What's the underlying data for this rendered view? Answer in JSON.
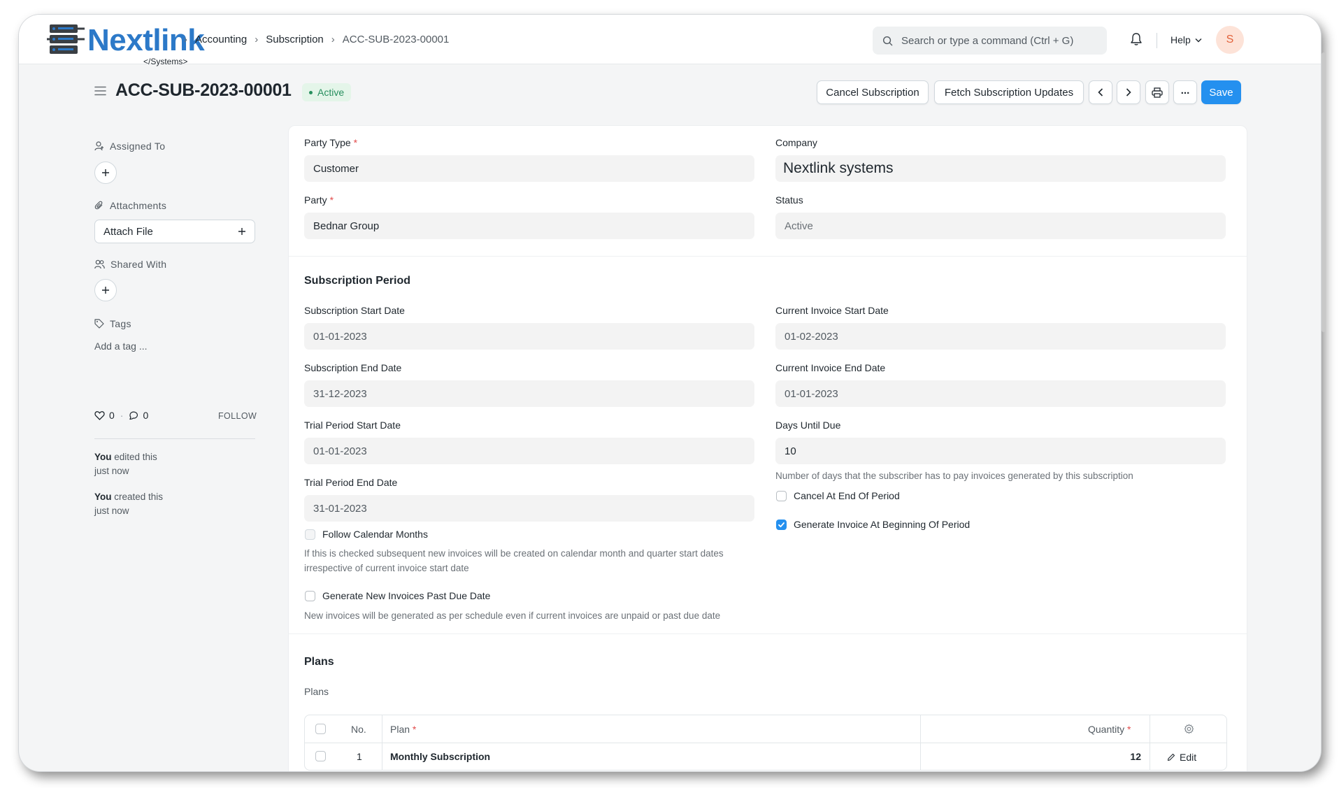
{
  "navbar": {
    "logo_text": "Nextlink",
    "logo_sub": "</Systems>",
    "breadcrumbs": [
      "Accounting",
      "Subscription",
      "ACC-SUB-2023-00001"
    ],
    "search_placeholder": "Search or type a command (Ctrl + G)",
    "help_label": "Help",
    "avatar_initial": "S"
  },
  "header": {
    "title": "ACC-SUB-2023-00001",
    "status": "Active",
    "buttons": {
      "cancel": "Cancel Subscription",
      "fetch": "Fetch Subscription Updates",
      "more": "...",
      "save": "Save"
    }
  },
  "sidebar": {
    "assigned_to": "Assigned To",
    "attachments": "Attachments",
    "attach_file": "Attach File",
    "shared_with": "Shared With",
    "tags": "Tags",
    "add_tag": "Add a tag ...",
    "likes": "0",
    "comments": "0",
    "follow": "FOLLOW",
    "activity": [
      {
        "who": "You",
        "action": " edited this",
        "when": "just now"
      },
      {
        "who": "You",
        "action": " created this",
        "when": "just now"
      }
    ]
  },
  "form": {
    "party_type_label": "Party Type",
    "party_type": "Customer",
    "company_label": "Company",
    "company": "Nextlink systems",
    "party_label": "Party",
    "party": "Bednar Group",
    "status_label": "Status",
    "status": "Active",
    "period_section": "Subscription Period",
    "sub_start_label": "Subscription Start Date",
    "sub_start": "01-01-2023",
    "sub_end_label": "Subscription End Date",
    "sub_end": "31-12-2023",
    "trial_start_label": "Trial Period Start Date",
    "trial_start": "01-01-2023",
    "trial_end_label": "Trial Period End Date",
    "trial_end": "31-01-2023",
    "cur_inv_start_label": "Current Invoice Start Date",
    "cur_inv_start": "01-02-2023",
    "cur_inv_end_label": "Current Invoice End Date",
    "cur_inv_end": "01-01-2023",
    "days_due_label": "Days Until Due",
    "days_due": "10",
    "days_due_desc": "Number of days that the subscriber has to pay invoices generated by this subscription",
    "cancel_end_label": "Cancel At End Of Period",
    "cancel_end_checked": false,
    "gen_begin_label": "Generate Invoice At Beginning Of Period",
    "gen_begin_checked": true,
    "follow_cal_label": "Follow Calendar Months",
    "follow_cal_desc_1": "If this is checked subsequent new invoices will be created on calendar month and quarter start dates",
    "follow_cal_desc_2": "irrespective of current invoice start date",
    "gen_past_due_label": "Generate New Invoices Past Due Date",
    "gen_past_due_desc": "New invoices will be generated as per schedule even if current invoices are unpaid or past due date",
    "plans_section": "Plans",
    "plans_label": "Plans"
  },
  "plans_table": {
    "columns": {
      "no": "No.",
      "plan": "Plan",
      "quantity": "Quantity"
    },
    "rows": [
      {
        "no": "1",
        "plan": "Monthly Subscription",
        "quantity": "12",
        "edit": "Edit"
      }
    ]
  },
  "colors": {
    "primary": "#2490ef",
    "brand": "#2c79c8",
    "active_badge": "#278f5e"
  }
}
